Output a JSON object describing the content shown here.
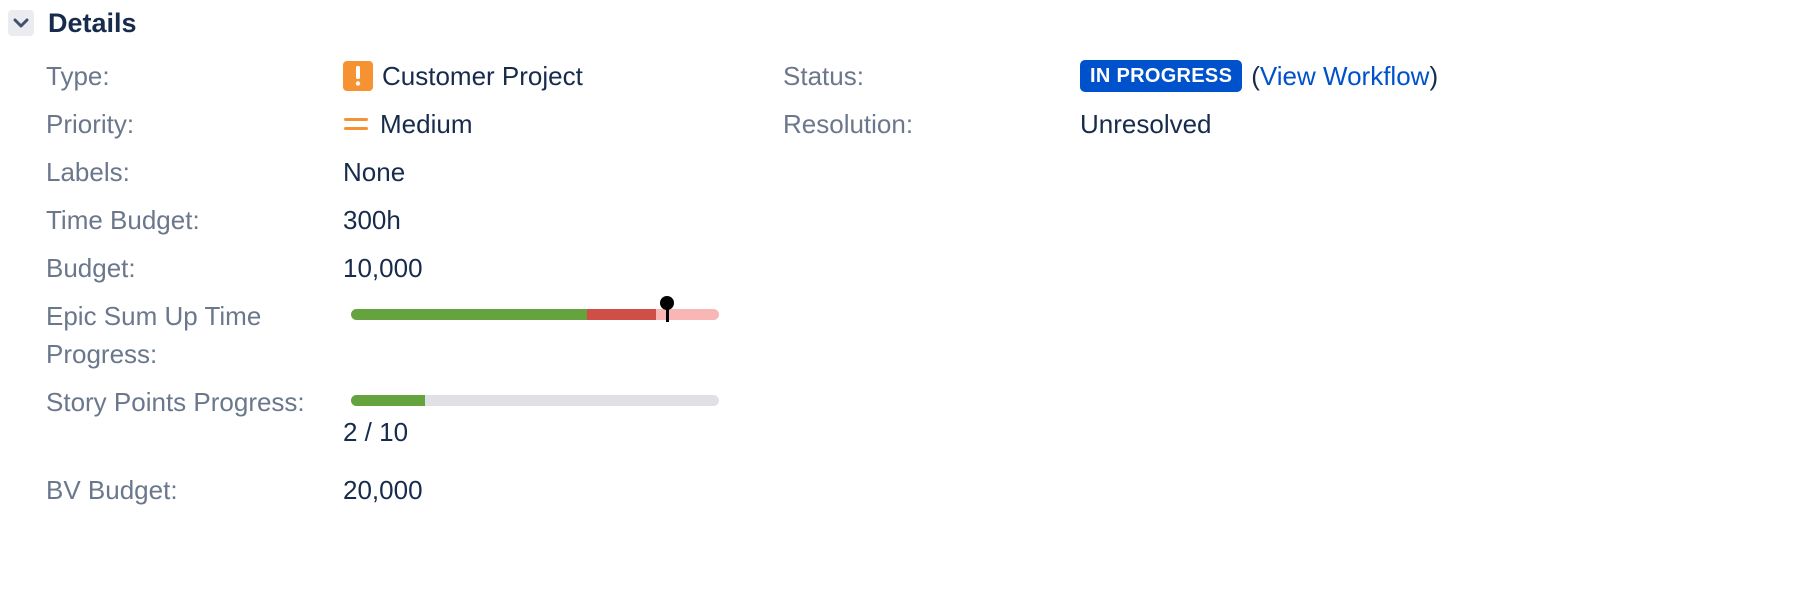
{
  "section": {
    "title": "Details"
  },
  "fields_left": {
    "type": {
      "label": "Type:",
      "value": "Customer Project",
      "icon": "exclamation-icon",
      "icon_color": "#f79232",
      "icon_glyph": "!"
    },
    "priority": {
      "label": "Priority:",
      "value": "Medium",
      "icon": "priority-medium-icon",
      "icon_color": "#f79232"
    },
    "labels": {
      "label": "Labels:",
      "value": "None"
    },
    "time_budget": {
      "label": "Time Budget:",
      "value": "300h"
    },
    "budget": {
      "label": "Budget:",
      "value": "10,000"
    },
    "epic_sum_up": {
      "label_line1": "Epic Sum Up Time",
      "label_line2": "Progress:",
      "progress": {
        "completed": 0.64,
        "overrun": 0.19,
        "remaining": 0.17,
        "marker": 0.86
      },
      "colors": {
        "completed": "#64a33d",
        "overrun": "#cf4f48",
        "remaining": "#f8b7b4",
        "marker": "#000000"
      }
    },
    "story_points": {
      "label": "Story Points Progress:",
      "value": "2 / 10",
      "progress": {
        "done": 2,
        "total": 10
      },
      "colors": {
        "done": "#64a33d",
        "track": "#dfe1e6"
      }
    },
    "bv_budget": {
      "label": "BV Budget:",
      "value": "20,000"
    }
  },
  "fields_right": {
    "status": {
      "label": "Status:",
      "value": "IN PROGRESS",
      "color": "#0052cc",
      "link_open": "(",
      "link_text": "View Workflow",
      "link_close": ")"
    },
    "resolution": {
      "label": "Resolution:",
      "value": "Unresolved"
    }
  },
  "icons": {
    "toggle": "chevron-down-icon"
  }
}
